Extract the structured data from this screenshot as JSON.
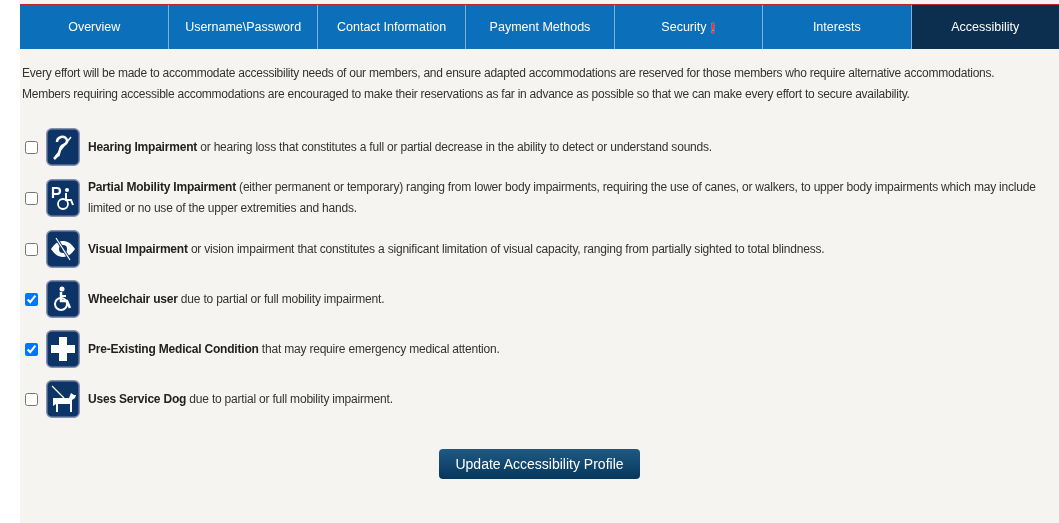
{
  "tabs": [
    {
      "label": "Overview",
      "selected": false
    },
    {
      "label": "Username\\Password",
      "selected": false
    },
    {
      "label": "Contact Information",
      "selected": false
    },
    {
      "label": "Payment Methods",
      "selected": false
    },
    {
      "label": "Security",
      "alert": "!",
      "selected": false
    },
    {
      "label": "Interests",
      "selected": false
    },
    {
      "label": "Accessibility",
      "selected": true
    }
  ],
  "intro": [
    "Every effort will be made to accommodate accessibility needs of our members, and ensure adapted accommodations are reserved for those members who require alternative accommodations.",
    "Members requiring accessible accommodations are encouraged to make their reservations as far in advance as possible so that we can make every effort to secure availability."
  ],
  "options": [
    {
      "text": "**Hearing Impairment** or hearing loss that constitutes a full or partial decrease in the ability to detect or understand sounds.",
      "checked": false
    },
    {
      "text": "**Partial Mobility Impairment** (either permanent or temporary) ranging from lower body impairments, requiring the use of canes, or walkers, to upper body impairments which may include limited or no use of the upper extremities and hands.",
      "checked": false
    },
    {
      "text": "**Visual Impairment** or vision impairment that constitutes a significant limitation of visual capacity, ranging from partially sighted to total blindness.",
      "checked": false
    },
    {
      "text": "**Wheelchair user** due to partial or full mobility impairment.",
      "checked": true
    },
    {
      "text": "**Pre-Existing Medical Condition** that may require emergency medical attention.",
      "checked": true
    },
    {
      "text": "**Uses Service Dog** due to partial or full mobility impairment.",
      "checked": false
    }
  ],
  "button": "Update Accessibility Profile"
}
